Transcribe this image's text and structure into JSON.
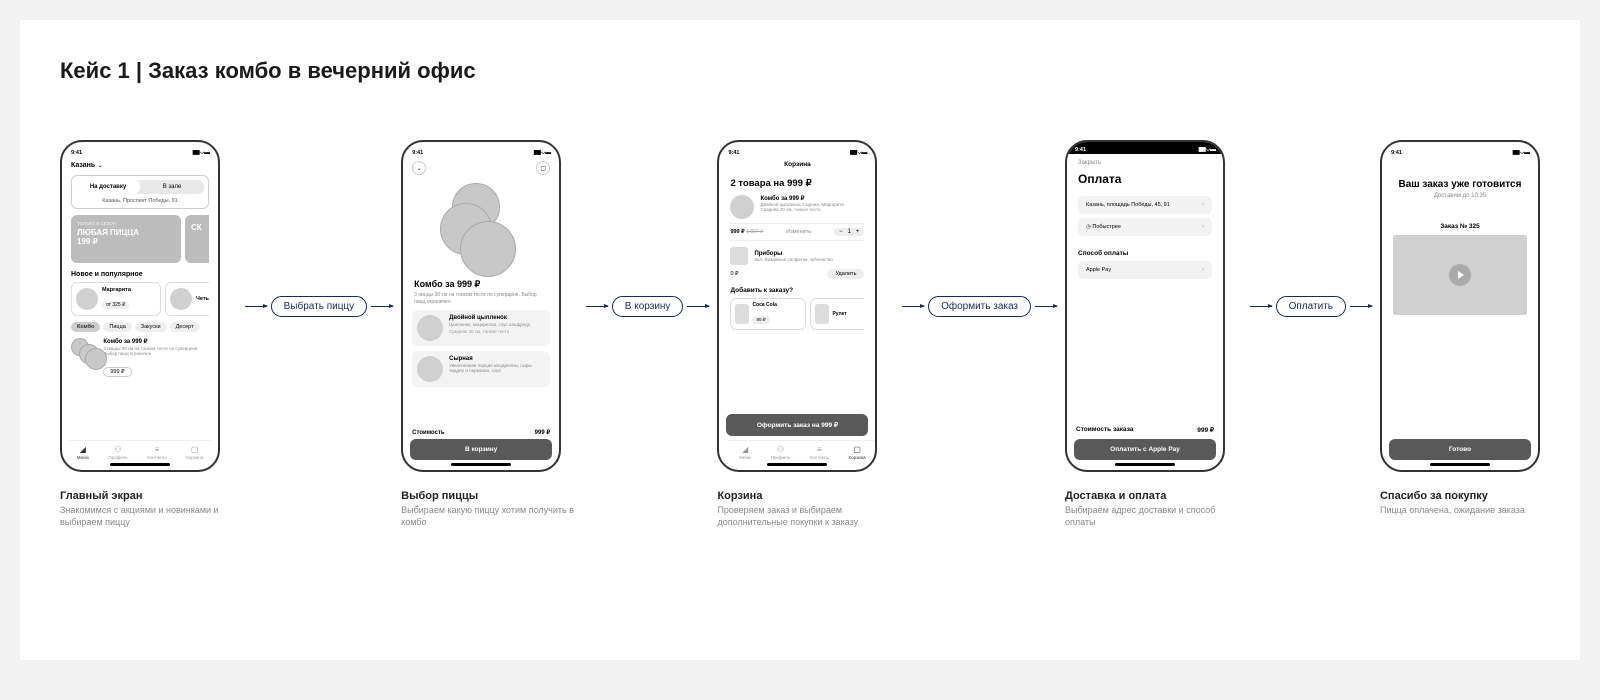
{
  "title": "Кейс 1 | Заказ  комбо в вечерний офис",
  "time": "9:41",
  "connectors": [
    "Выбрать пиццу",
    "В корзину",
    "Оформить заказ",
    "Оплатить"
  ],
  "s1": {
    "city": "Казань",
    "tab1": "На доставку",
    "tab2": "В зале",
    "address": "Казань, Проспект Победы, 91",
    "banner_tag": "ТОЛЬКО В СЕЗОН",
    "banner_big1": "ЛЮБАЯ ПИЦЦА",
    "banner_big2": "199 ₽",
    "banner2": "СК",
    "section": "Новое и популярное",
    "p1_name": "Маргарита",
    "p1_price": "от 325 ₽",
    "p2_name": "Четыр",
    "chips": [
      "Комбо",
      "Пицца",
      "Закуски",
      "Десерт"
    ],
    "combo_t": "Комбо за 999 ₽",
    "combo_d": "3 пиццы 30 см на тонком тесте по суперцене. Выбор пицц ограничен",
    "combo_p": "999 ₽",
    "nav": [
      "Меню",
      "Профиль",
      "Контакты",
      "Корзина"
    ],
    "cap_t": "Главный экран",
    "cap_d": "Знакомимся с акциями и новинками и выбираем пиццу"
  },
  "s2": {
    "title": "Комбо за 999 ₽",
    "desc": "3 пиццы 30 см на тонком тесте по суперцене. Выбор пицц ограничен",
    "opt1_t": "Двойной цыпленок",
    "opt1_d": "Цыпленок, моцарелла, соус альфредо",
    "opt1_s": "Средняя 30 см, тонкое тесто",
    "opt2_t": "Сырная",
    "opt2_d": "Увеличенная порция моцареллы, сыры чеддер и пармезан, соус",
    "cost_l": "Стоимость",
    "cost_v": "999 ₽",
    "btn": "В корзину",
    "cap_t": "Выбор пиццы",
    "cap_d": "Выбираем какую пиццу хотим получить в комбо"
  },
  "s3": {
    "page": "Корзина",
    "header": "2 товара на 999  ₽",
    "item_t": "Комбо за 999 ₽",
    "item_d1": "Двойной цыпленок, Сырная, Маргарита",
    "item_d2": "Средняя 30 см, тонкое тесто",
    "price": "999 ₽",
    "old": "1 397 ₽",
    "change": "Изменить",
    "qty": "1",
    "util_t": "Приборы",
    "util_d": "5шт, бумажные салфетки, зубочистки",
    "util_p": "0 ₽",
    "del": "Удалить",
    "upsell_h": "Добавить к заказу?",
    "up1_t": "Coca Cola",
    "up1_p": "90 ₽",
    "up2_t": "Рулет",
    "btn": "Оформить заказ на 999 ₽",
    "nav": [
      "Меню",
      "Профиль",
      "Контакты",
      "Корзина"
    ],
    "cap_t": "Корзина",
    "cap_d": "Проверяем заказ и выбираем дополнительные покупки к заказу"
  },
  "s4": {
    "close": "Закрыть",
    "title": "Оплата",
    "addr": "Казань, площадь Победы, 45, 91",
    "speed": "Побыстрее",
    "method_h": "Способ оплаты",
    "method": "Apple Pay",
    "total_l": "Стоимость заказа",
    "total_v": "999 ₽",
    "btn": "Оплатить с Apple Pay",
    "cap_t": "Доставка и оплата",
    "cap_d": "Выбираем адрес доставки и способ оплаты"
  },
  "s5": {
    "h1": "Ваш заказ уже готовится",
    "eta": "Доставим до 10:35",
    "order": "Заказ № 325",
    "btn": "Готово",
    "cap_t": "Спасибо за покупку",
    "cap_d": "Пицца оплачена, ожидание заказа"
  }
}
